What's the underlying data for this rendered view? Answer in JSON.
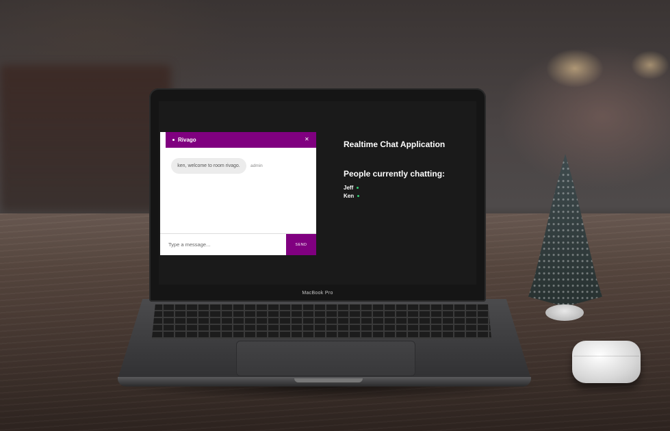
{
  "device": {
    "brand_label": "MacBook Pro"
  },
  "chat_window": {
    "room_name": "Rivago",
    "close_icon": "close-icon",
    "messages": [
      {
        "text": "ken, welcome to room rivago.",
        "author": "admin"
      }
    ],
    "input": {
      "placeholder": "Type a message...",
      "value": ""
    },
    "send_label": "SEND",
    "accent_color": "#800080"
  },
  "sidebar": {
    "app_title": "Realtime Chat Application",
    "people_title": "People currently chatting:",
    "users": [
      {
        "name": "Jeff",
        "status": "online"
      },
      {
        "name": "Ken",
        "status": "online"
      }
    ],
    "online_color": "#2ecc71"
  }
}
